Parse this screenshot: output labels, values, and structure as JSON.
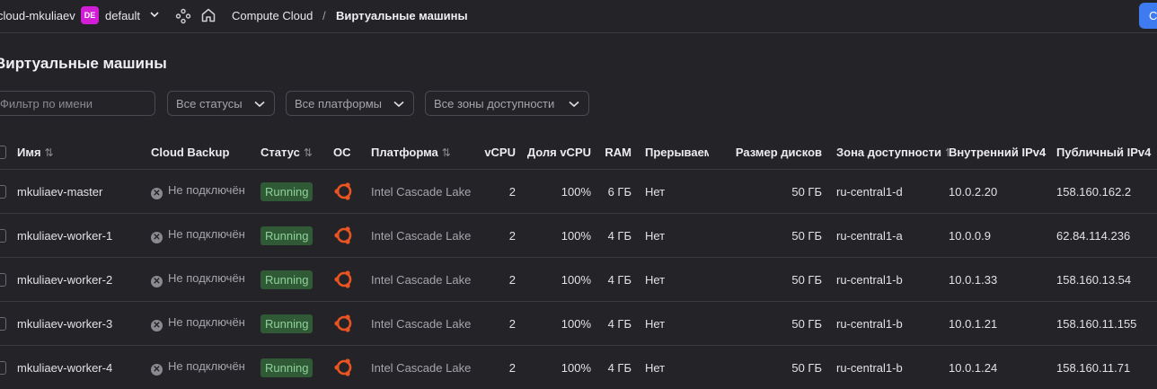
{
  "header": {
    "cloud_name": "cloud-mkuliaev",
    "folder_badge": "DE",
    "folder_name": "default",
    "breadcrumb_service": "Compute Cloud",
    "breadcrumb_sep": "/",
    "breadcrumb_page": "Виртуальные машины",
    "create_button": "Создать",
    "accent": "#3f7bf0",
    "badge_color": "#d11ed6"
  },
  "page": {
    "title": "Виртуальные машины"
  },
  "filters": {
    "name_placeholder": "Фильтр по имени",
    "status_select": "Все статусы",
    "platform_select": "Все платформы",
    "zone_select": "Все зоны доступности"
  },
  "table": {
    "columns": {
      "name": "Имя",
      "backup": "Cloud Backup",
      "status": "Статус",
      "os": "ОС",
      "platform": "Платформа",
      "vcpu": "vCPU",
      "cpu_share": "Доля vCPU",
      "ram": "RAM",
      "preemptible": "Прерываемая",
      "disk": "Размер дисков",
      "zone": "Зона доступности",
      "internal_ip": "Внутренний IPv4",
      "public_ip": "Публичный IPv4"
    },
    "sort_icon": "⇅",
    "rows": [
      {
        "name": "mkuliaev-master",
        "backup": "Не подключён",
        "status": "Running",
        "os": "ubuntu-icon",
        "platform": "Intel Cascade Lake",
        "vcpu": "2",
        "cpu_share": "100%",
        "ram": "6 ГБ",
        "preemptible": "Нет",
        "disk": "50 ГБ",
        "zone": "ru-central1-d",
        "internal_ip": "10.0.2.20",
        "public_ip": "158.160.162.2"
      },
      {
        "name": "mkuliaev-worker-1",
        "backup": "Не подключён",
        "status": "Running",
        "os": "ubuntu-icon",
        "platform": "Intel Cascade Lake",
        "vcpu": "2",
        "cpu_share": "100%",
        "ram": "4 ГБ",
        "preemptible": "Нет",
        "disk": "50 ГБ",
        "zone": "ru-central1-a",
        "internal_ip": "10.0.0.9",
        "public_ip": "62.84.114.236"
      },
      {
        "name": "mkuliaev-worker-2",
        "backup": "Не подключён",
        "status": "Running",
        "os": "ubuntu-icon",
        "platform": "Intel Cascade Lake",
        "vcpu": "2",
        "cpu_share": "100%",
        "ram": "4 ГБ",
        "preemptible": "Нет",
        "disk": "50 ГБ",
        "zone": "ru-central1-b",
        "internal_ip": "10.0.1.33",
        "public_ip": "158.160.13.54"
      },
      {
        "name": "mkuliaev-worker-3",
        "backup": "Не подключён",
        "status": "Running",
        "os": "ubuntu-icon",
        "platform": "Intel Cascade Lake",
        "vcpu": "2",
        "cpu_share": "100%",
        "ram": "4 ГБ",
        "preemptible": "Нет",
        "disk": "50 ГБ",
        "zone": "ru-central1-b",
        "internal_ip": "10.0.1.21",
        "public_ip": "158.160.11.155"
      },
      {
        "name": "mkuliaev-worker-4",
        "backup": "Не подключён",
        "status": "Running",
        "os": "ubuntu-icon",
        "platform": "Intel Cascade Lake",
        "vcpu": "2",
        "cpu_share": "100%",
        "ram": "4 ГБ",
        "preemptible": "Нет",
        "disk": "50 ГБ",
        "zone": "ru-central1-b",
        "internal_ip": "10.0.1.24",
        "public_ip": "158.160.11.71"
      }
    ]
  }
}
